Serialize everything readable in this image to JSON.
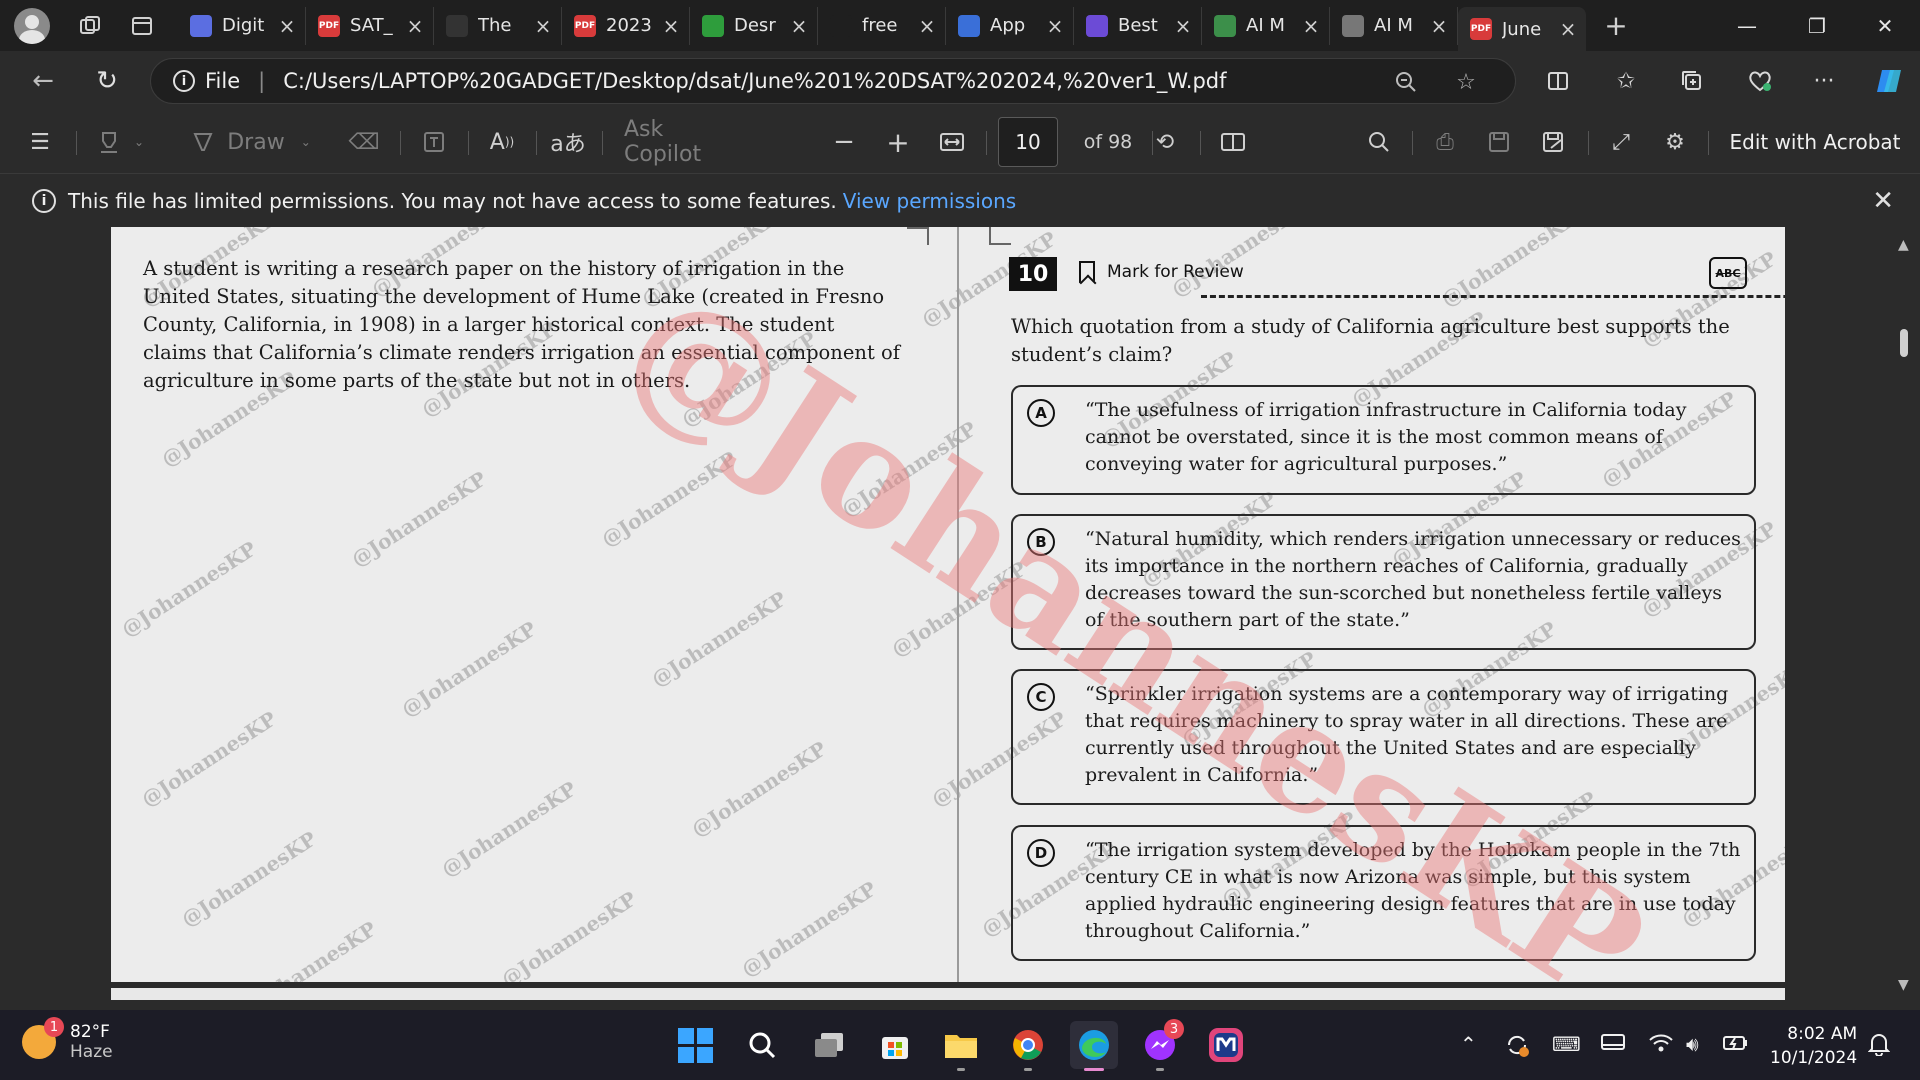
{
  "browser": {
    "tabs": [
      {
        "label": "Digit",
        "favicon": "digit-favicon",
        "color": "#5b6ee1"
      },
      {
        "label": "SAT_",
        "favicon": "pdf-favicon",
        "color": "#d83b3b"
      },
      {
        "label": "The",
        "favicon": "dark-favicon",
        "color": "#333333"
      },
      {
        "label": "2023",
        "favicon": "pdf-favicon",
        "color": "#d83b3b"
      },
      {
        "label": "Desr",
        "favicon": "desmos-favicon",
        "color": "#2e9d3c"
      },
      {
        "label": "free",
        "favicon": "search-favicon",
        "color": "#1f1f1f"
      },
      {
        "label": "App",
        "favicon": "shield-favicon",
        "color": "#3a6fd8"
      },
      {
        "label": "Best",
        "favicon": "cube-favicon",
        "color": "#6c4bd6"
      },
      {
        "label": "AI M",
        "favicon": "ai-favicon",
        "color": "#3c8f4a"
      },
      {
        "label": "AI M",
        "favicon": "ai2-favicon",
        "color": "#777777"
      },
      {
        "label": "June",
        "favicon": "pdf-favicon",
        "color": "#d83b3b",
        "active": true
      }
    ],
    "address": {
      "scheme": "File",
      "url": "C:/Users/LAPTOP%20GADGET/Desktop/dsat/June%201%20DSAT%202024,%20ver1_W.pdf"
    }
  },
  "pdf_toolbar": {
    "draw_label": "Draw",
    "ask_copilot": "Ask Copilot",
    "page_current": "10",
    "page_total": "of 98",
    "edit_acrobat": "Edit with Acrobat"
  },
  "infobar": {
    "message": "This file has limited permissions. You may not have access to some features.",
    "link": "View permissions"
  },
  "document": {
    "passage": "A student is writing a research paper on the history of irrigation in the United States, situating the development of Hume Lake (created in Fresno County, California, in 1908) in a larger historical context. The student claims that California’s climate renders irrigation an essential component of agriculture in some parts of the state but not in others.",
    "question_number": "10",
    "mark_for_review": "Mark for Review",
    "abc_icon": "ABC",
    "question": "Which quotation from a study of California agriculture best supports the student’s claim?",
    "choices": [
      {
        "letter": "A",
        "text": "“The usefulness of irrigation infrastructure in California today cannot be overstated, since it is the most common means of conveying water for agricultural purposes.”"
      },
      {
        "letter": "B",
        "text": "“Natural humidity, which renders irrigation unnecessary or reduces its importance in the northern reaches of California, gradually decreases toward the sun-scorched but nonetheless fertile valleys of the southern part of the state.”"
      },
      {
        "letter": "C",
        "text": "“Sprinkler irrigation systems are a contemporary way of irrigating that requires machinery to spray water in all directions. These are currently used throughout the United States and are especially prevalent in California.”"
      },
      {
        "letter": "D",
        "text": "“The irrigation system developed by the Hohokam people in the 7th century CE in what is now Arizona was simple, but this system applied hydraulic engineering design features that are in use today throughout California.”"
      }
    ],
    "watermark_small": "@JohannesKP",
    "watermark_big": "@JohannesKP"
  },
  "taskbar": {
    "weather_temp": "82°F",
    "weather_desc": "Haze",
    "weather_badge": "1",
    "messenger_badge": "3",
    "time": "8:02 AM",
    "date": "10/1/2024"
  }
}
